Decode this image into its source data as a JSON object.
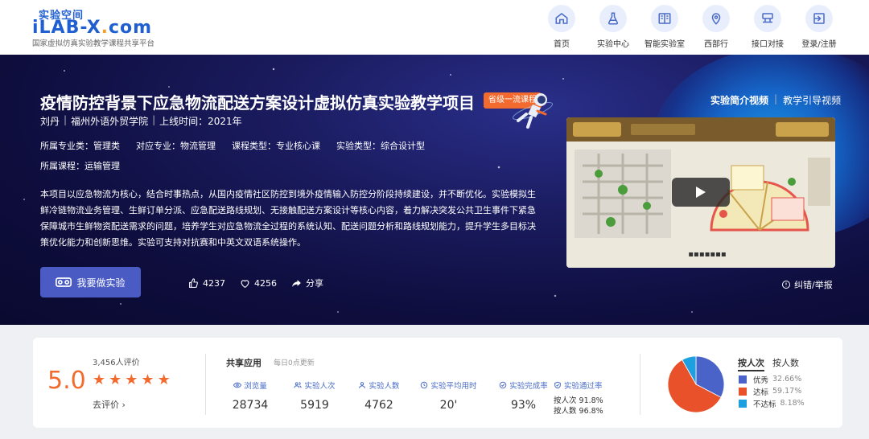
{
  "header": {
    "logo_small": "实验空间",
    "logo_main": "iLAB-X",
    "logo_dot": ".",
    "logo_com": "com",
    "logo_sub": "国家虚拟仿真实验教学课程共享平台",
    "nav": [
      {
        "label": "首页",
        "icon": "home-icon"
      },
      {
        "label": "实验中心",
        "icon": "flask-icon"
      },
      {
        "label": "智能实验室",
        "icon": "lab-book-icon"
      },
      {
        "label": "西部行",
        "icon": "location-icon"
      },
      {
        "label": "接口对接",
        "icon": "interface-icon"
      },
      {
        "label": "登录/注册",
        "icon": "login-icon"
      }
    ],
    "accent": "#1f5fd0"
  },
  "project": {
    "title": "疫情防控背景下应急物流配送方案设计虚拟仿真实验教学项目",
    "badge": "省级一流课程",
    "author": "刘丹",
    "school": "福州外语外贸学院",
    "online": "上线时间：2021年",
    "tags": [
      "所属专业类：管理类",
      "对应专业：物流管理",
      "课程类型：专业核心课",
      "实验类型：综合设计型"
    ],
    "course": "所属课程：运输管理",
    "description": "本项目以应急物流为核心，结合时事热点，从国内疫情社区防控到境外疫情输入防控分阶段持续建设，并不断优化。实验模拟生鲜冷链物流业务管理、生鲜订单分派、应急配送路线规划、无接触配送方案设计等核心内容，着力解决突发公共卫生事件下紧急保障城市生鲜物资配送需求的问题，培养学生对应急物流全过程的系统认知、配送问题分析和路线规划能力，提升学生多目标决策优化能力和创新思维。实验可支持对抗赛和中英文双语系统操作。",
    "do_button": "我要做实验",
    "likes": "4237",
    "favorites": "4256",
    "share": "分享",
    "video_tabs": [
      "实验简介视频",
      "教学引导视频"
    ],
    "report": "纠错/举报"
  },
  "stats": {
    "score": "5.0",
    "rating_count": "3,456人评价",
    "stars": [
      "★",
      "★",
      "★",
      "★",
      "★"
    ],
    "go_rate": "去评价 ›",
    "share_title": "共享应用",
    "share_sub": "每日0点更新",
    "metrics": [
      {
        "label": "浏览量",
        "value": "28734",
        "icon": "eye-icon"
      },
      {
        "label": "实验人次",
        "value": "5919",
        "icon": "users-icon"
      },
      {
        "label": "实验人数",
        "value": "4762",
        "icon": "user-icon"
      },
      {
        "label": "实验平均用时",
        "value": "20'",
        "icon": "clock-icon"
      },
      {
        "label": "实验完成率",
        "value": "93%",
        "icon": "check-circle-icon"
      }
    ],
    "pass_label": "实验通过率",
    "pass_by_times": "按人次 91.8%",
    "pass_by_people": "按人数 96.8%",
    "pie_tabs": [
      "按人次",
      "按人数"
    ],
    "accent": "#f26a2e"
  },
  "chart_data": {
    "type": "pie",
    "categories": [
      "优秀",
      "达标",
      "不达标"
    ],
    "values": [
      32.66,
      59.17,
      8.18
    ],
    "labels": [
      "32.66%",
      "59.17%",
      "8.18%"
    ],
    "colors": [
      "#4a63c8",
      "#e8512a",
      "#1ea0e0"
    ],
    "legend": "right"
  }
}
